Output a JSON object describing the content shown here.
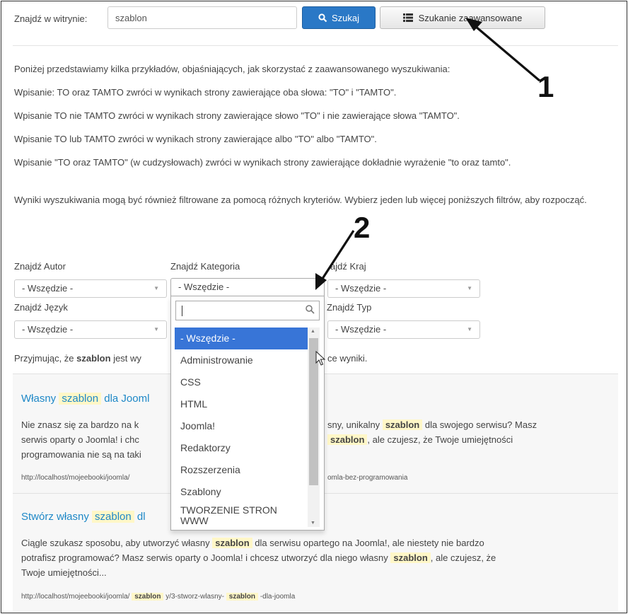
{
  "search": {
    "label": "Znajdź w witrynie:",
    "value": "szablon",
    "search_button": "Szukaj",
    "advanced_button": "Szukanie zaawansowane"
  },
  "intro": {
    "line1": "Poniżej przedstawiamy kilka przykładów, objaśniających, jak skorzystać z zaawansowanego wyszukiwania:",
    "line2": "Wpisanie: TO oraz TAMTO zwróci w wynikach strony zawierające oba słowa: \"TO\" i \"TAMTO\".",
    "line3": "Wpisanie TO nie TAMTO zwróci w wynikach strony zawierające słowo \"TO\" i nie zawierające słowa \"TAMTO\".",
    "line4": "Wpisanie TO lub TAMTO zwróci w wynikach strony zawierające albo \"TO\" albo \"TAMTO\".",
    "line5": "Wpisanie \"TO oraz TAMTO\" (w cudzysłowach) zwróci w wynikach strony zawierające dokładnie wyrażenie \"to oraz tamto\".",
    "line6": "Wyniki wyszukiwania mogą być również filtrowane za pomocą różnych kryteriów. Wybierz jeden lub więcej poniższych filtrów, aby rozpocząć."
  },
  "filters": {
    "author_label": "Znajdź Autor",
    "category_label": "Znajdź Kategoria",
    "country_label": "Znajdź Kraj",
    "country_label_visible": "ajdź Kraj",
    "language_label": "Znajdź Język",
    "type_label": "Znajdź Typ",
    "any": "- Wszędzie -"
  },
  "dropdown": {
    "items": [
      "- Wszędzie -",
      "Administrowanie",
      "CSS",
      "HTML",
      "Joomla!",
      "Redaktorzy",
      "Rozszerzenia",
      "Szablony",
      "TWORZENIE STRON WWW"
    ]
  },
  "summary": {
    "prefix": "Przyjmując, że",
    "term": "szablon",
    "middle": "jest wy",
    "suffix": "ce wyniki."
  },
  "results": [
    {
      "title_a": "Własny",
      "term": "szablon",
      "title_b": "dla Jooml",
      "line1_a": "Nie znasz się za bardzo na k",
      "line1_b": "sny, unikalny",
      "line1_c": "dla swojego serwisu? Masz",
      "line2_a": "serwis oparty o Joomla! i chc",
      "line2_b": ", ale czujesz, że Twoje umiejętności",
      "line3": "programowania nie są na taki",
      "url_a": "http://localhost/mojeebooki/joomla/",
      "url_b": "omla-bez-programowania"
    },
    {
      "title_a": "Stwórz własny",
      "term": "szablon",
      "title_b": "dl",
      "line1_a": "Ciągle szukasz sposobu, aby utworzyć własny",
      "line1_b": "dla serwisu opartego na Joomla!, ale niestety nie bardzo",
      "line2_a": "potrafisz programować? Masz serwis oparty o Joomla! i chcesz utworzyć dla niego własny",
      "line2_b": ", ale czujesz, że",
      "line3": "Twoje umiejętności...",
      "url_a": "http://localhost/mojeebooki/joomla/",
      "url_b": "y/3-stworz-wlasny-",
      "url_c": "-dla-joomla"
    }
  ],
  "annotations": {
    "one": "1",
    "two": "2"
  }
}
